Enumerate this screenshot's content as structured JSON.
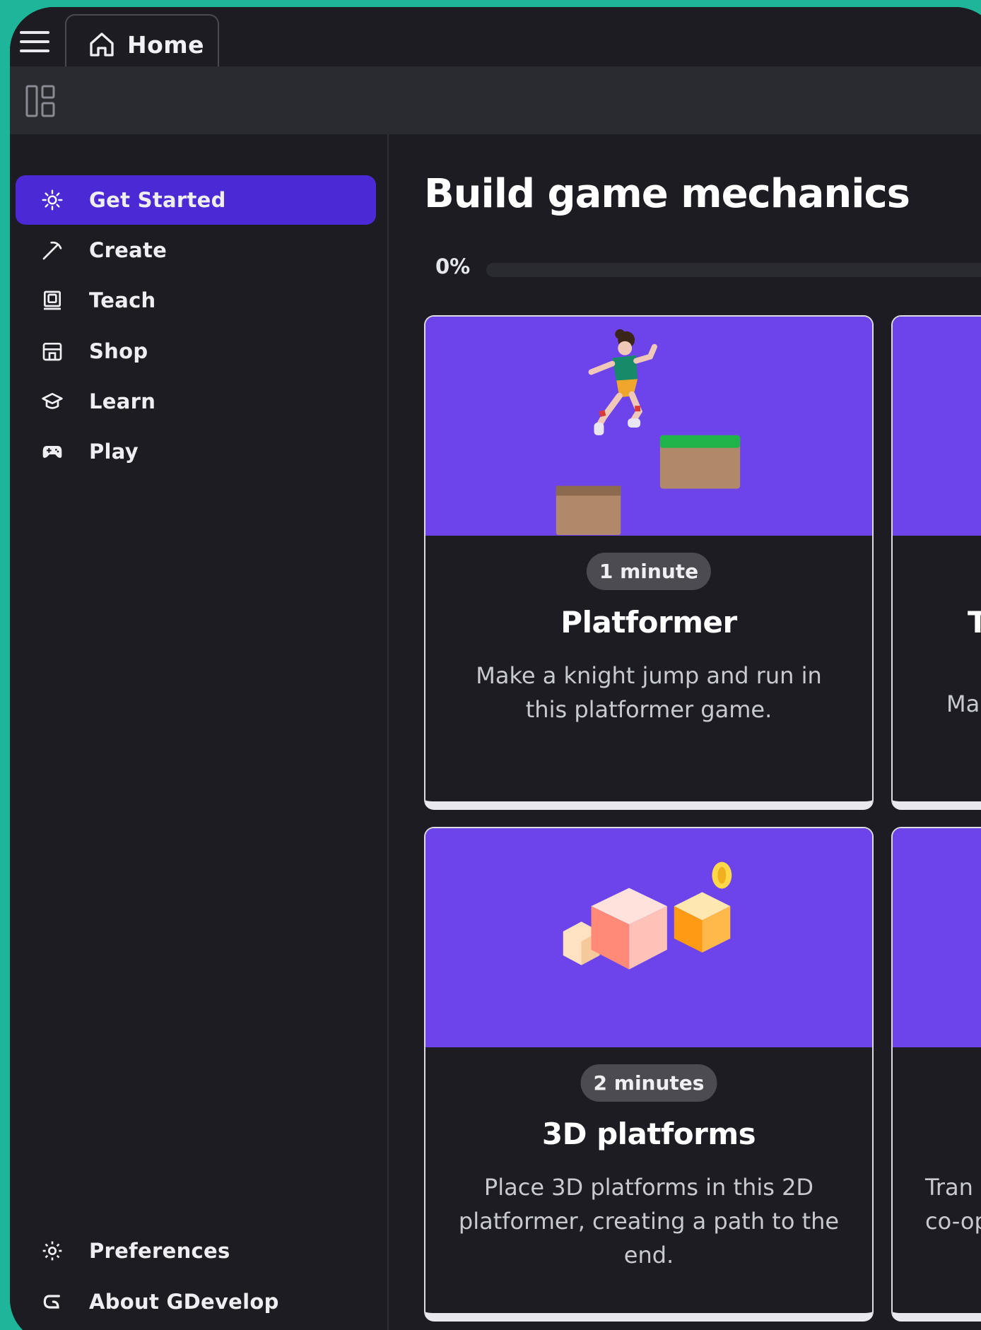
{
  "tabbar": {
    "menu_icon": "hamburger-icon",
    "home_tab": {
      "label": "Home",
      "icon": "home-icon"
    }
  },
  "toolbar": {
    "panel_icon": "panels-layout-icon"
  },
  "sidebar": {
    "items": [
      {
        "label": "Get Started",
        "icon": "sparkle-icon",
        "active": true
      },
      {
        "label": "Create",
        "icon": "pickaxe-icon",
        "active": false
      },
      {
        "label": "Teach",
        "icon": "board-icon",
        "active": false
      },
      {
        "label": "Shop",
        "icon": "store-icon",
        "active": false
      },
      {
        "label": "Learn",
        "icon": "graduation-cap-icon",
        "active": false
      },
      {
        "label": "Play",
        "icon": "gamepad-icon",
        "active": false
      }
    ],
    "bottom_items": [
      {
        "label": "Preferences",
        "icon": "gear-icon"
      },
      {
        "label": "About GDevelop",
        "icon": "gdevelop-logo-icon"
      }
    ]
  },
  "main": {
    "title": "Build game mechanics",
    "progress": {
      "text": "0%",
      "value": 0
    },
    "cards": [
      {
        "duration": "1 minute",
        "title": "Platformer",
        "description": "Make a knight jump and run in this platformer game.",
        "illustration": "jumping-character-platforms"
      },
      {
        "duration": "",
        "title": "T",
        "description": "Mak",
        "illustration": ""
      },
      {
        "duration": "2 minutes",
        "title": "3D platforms",
        "description": "Place 3D platforms in this 2D platformer, creating a path to the end.",
        "illustration": "3d-cubes-coin"
      },
      {
        "duration": "",
        "title": "",
        "description": "Tran co-op",
        "illustration": ""
      }
    ]
  },
  "colors": {
    "accent": "#4b2ad6",
    "card_banner": "#6d44ea",
    "background": "#1c1c22",
    "frame": "#1fb59a"
  }
}
